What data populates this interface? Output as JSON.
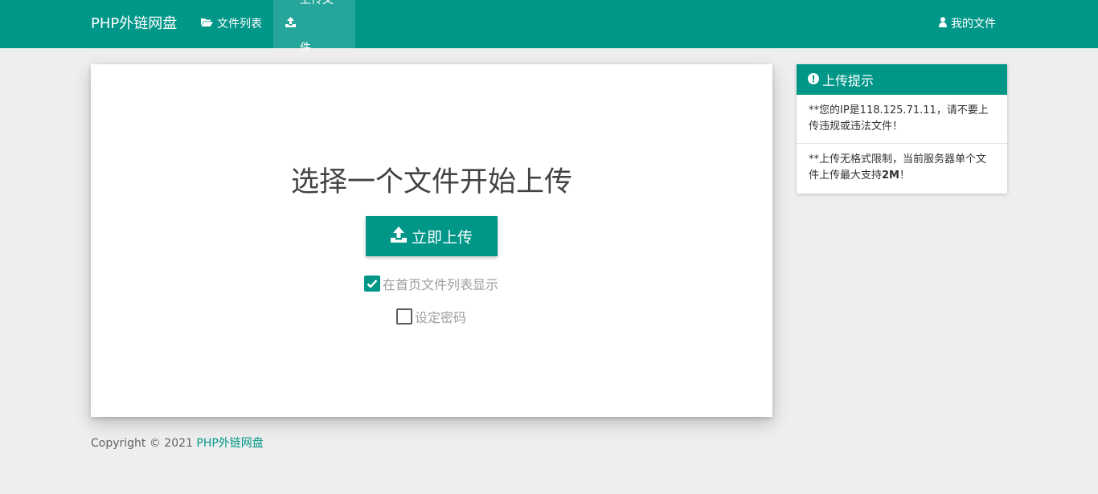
{
  "nav": {
    "brand": "PHP外链网盘",
    "items": [
      {
        "label": "文件列表",
        "icon": "folder-open-icon"
      },
      {
        "label": "上传文件",
        "icon": "upload-icon",
        "active": true
      }
    ],
    "right_item": {
      "label": "我的文件",
      "icon": "user-icon"
    }
  },
  "upload": {
    "title": "选择一个文件开始上传",
    "button_label": "立即上传",
    "options": [
      {
        "label": "在首页文件列表显示",
        "checked": true
      },
      {
        "label": "设定密码",
        "checked": false
      }
    ]
  },
  "tips": {
    "header": "上传提示",
    "items": [
      {
        "text": "**您的IP是118.125.71.11，请不要上传违规或违法文件！"
      },
      {
        "prefix": "**上传无格式限制，当前服务器单个文件上传最大支持",
        "bold": "2M",
        "suffix": "！"
      }
    ]
  },
  "footer": {
    "copyright": "Copyright © 2021",
    "link": "PHP外链网盘"
  },
  "colors": {
    "primary": "#009688",
    "active_nav": "#26a69a",
    "background": "#eeeeee"
  }
}
